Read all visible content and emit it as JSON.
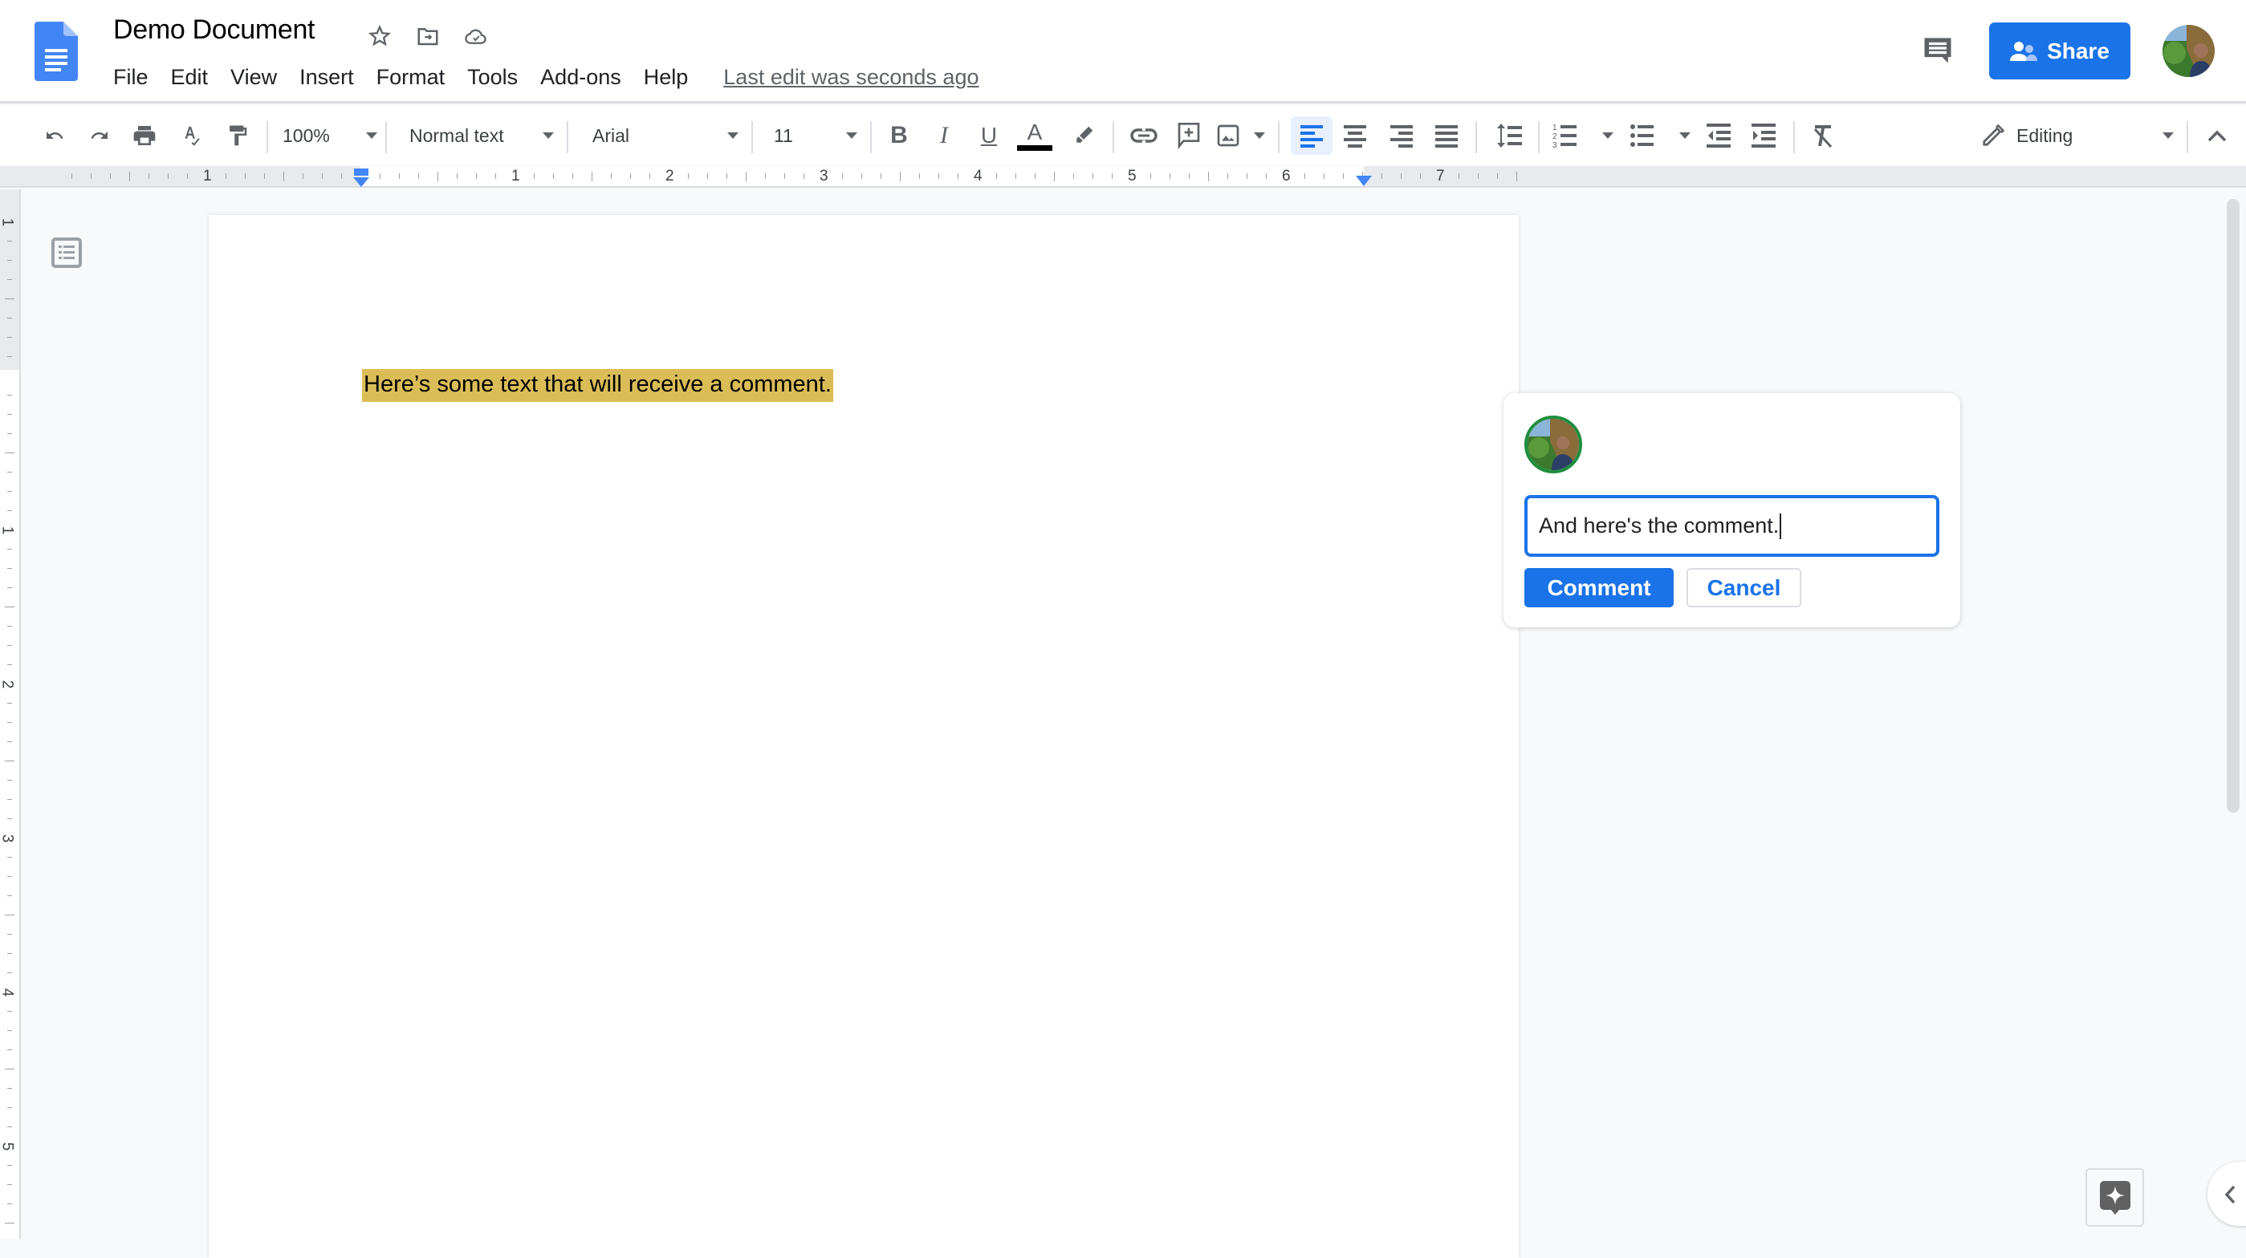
{
  "header": {
    "title": "Demo Document",
    "menu": [
      "File",
      "Edit",
      "View",
      "Insert",
      "Format",
      "Tools",
      "Add-ons",
      "Help"
    ],
    "last_edit": "Last edit was seconds ago",
    "share_label": "Share"
  },
  "toolbar": {
    "zoom": "100%",
    "style": "Normal text",
    "font": "Arial",
    "font_size": "11",
    "mode": "Editing",
    "text_color": "#000000",
    "active_alignment": "left"
  },
  "ruler": {
    "labels": [
      "1",
      "1",
      "2",
      "3",
      "4",
      "5",
      "6",
      "7"
    ],
    "vertical_labels": [
      "1",
      "1",
      "2",
      "3",
      "4",
      "5"
    ]
  },
  "document": {
    "body_text": "Here’s some text that will receive a comment.",
    "highlight_color": "#dbbd58"
  },
  "comment": {
    "input_value": "And here's the comment.",
    "submit_label": "Comment",
    "cancel_label": "Cancel"
  },
  "colors": {
    "accent": "#1a73e8",
    "avatar_ring": "#1e8e3e"
  }
}
